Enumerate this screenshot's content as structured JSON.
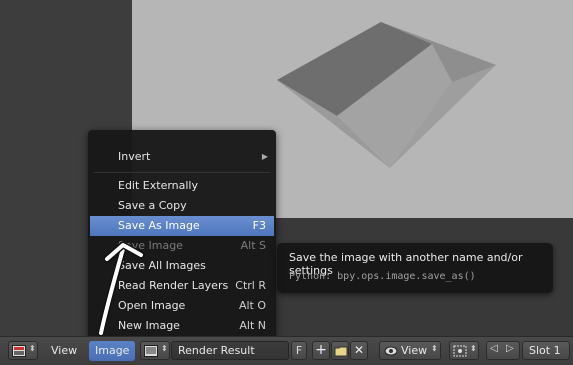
{
  "menu": {
    "items": [
      {
        "label": "Invert",
        "shortcut": "",
        "submenu": true,
        "state": "normal"
      },
      {
        "label": "Edit Externally",
        "shortcut": "",
        "state": "normal"
      },
      {
        "label": "Save a Copy",
        "shortcut": "",
        "state": "normal"
      },
      {
        "label": "Save As Image",
        "shortcut": "F3",
        "state": "highlight"
      },
      {
        "label": "Save Image",
        "shortcut": "Alt S",
        "state": "disabled"
      },
      {
        "label": "Save All Images",
        "shortcut": "",
        "state": "normal"
      },
      {
        "label": "Read Render Layers",
        "shortcut": "Ctrl R",
        "state": "normal"
      },
      {
        "label": "Open Image",
        "shortcut": "Alt O",
        "state": "normal"
      },
      {
        "label": "New Image",
        "shortcut": "Alt N",
        "state": "normal"
      }
    ]
  },
  "tooltip": {
    "title": "Save the image with another name and/or settings",
    "python": "Python: bpy.ops.image.save_as()"
  },
  "header": {
    "view_menu": "View",
    "image_menu": "Image",
    "image_name": "Render Result",
    "fake_user": "F",
    "view_dropdown": "View",
    "slot": "Slot 1"
  },
  "colors": {
    "highlight": "#5a80c8",
    "menu_bg": "#181818",
    "viewport": "#b5b5b5"
  }
}
